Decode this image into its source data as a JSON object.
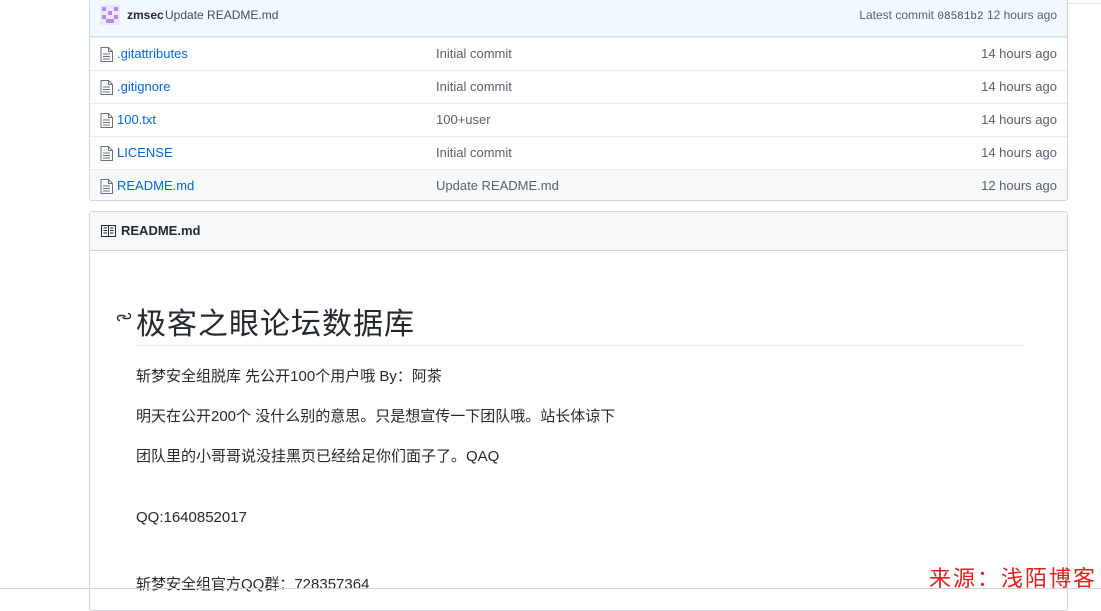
{
  "latest_commit": {
    "author": "zmsec",
    "message": "Update README.md",
    "label": "Latest commit",
    "sha": "08581b2",
    "age": "12 hours ago"
  },
  "files": [
    {
      "name": ".gitattributes",
      "message": "Initial commit",
      "age": "14 hours ago"
    },
    {
      "name": ".gitignore",
      "message": "Initial commit",
      "age": "14 hours ago"
    },
    {
      "name": "100.txt",
      "message": "100+user",
      "age": "14 hours ago"
    },
    {
      "name": "LICENSE",
      "message": "Initial commit",
      "age": "14 hours ago"
    },
    {
      "name": "README.md",
      "message": "Update README.md",
      "age": "12 hours ago"
    }
  ],
  "readme": {
    "header": "README.md",
    "heading": "极客之眼论坛数据库",
    "paragraphs": [
      "斩梦安全组脱库 先公开100个用户哦 By：阿茶",
      "明天在公开200个 没什么别的意思。只是想宣传一下团队哦。站长体谅下",
      "团队里的小哥哥说没挂黑页已经给足你们面子了。QAQ",
      "QQ:1640852017",
      "斩梦安全组官方QQ群：728357364"
    ]
  },
  "watermark": "来源：浅陌博客",
  "colors": {
    "link": "#0366d6",
    "accent": "#2188ff",
    "watermark": "#e02020"
  }
}
